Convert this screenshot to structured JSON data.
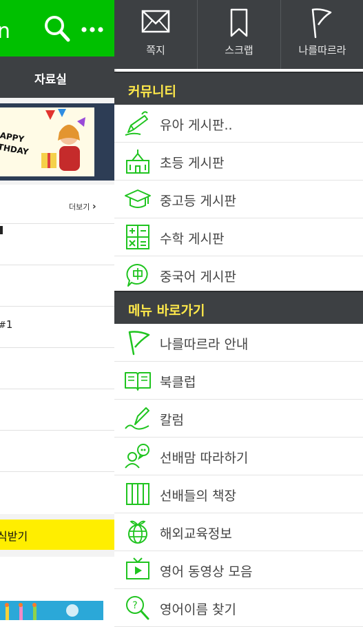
{
  "colors": {
    "brand_green": "#00c000",
    "drawer_dark": "#3d4043",
    "section_text": "#ffe94a",
    "icon_green": "#1fc41f"
  },
  "background_app": {
    "logo_fragment": "n",
    "tab_label": "자료실",
    "banner_text": "APPY\nTHDAY",
    "more_label": "더보기",
    "list_fragments": [
      "1"
    ],
    "yellow_bar_text": "식받기"
  },
  "drawer": {
    "top_buttons": [
      {
        "label": "쪽지",
        "icon": "envelope-icon"
      },
      {
        "label": "스크랩",
        "icon": "bookmark-icon"
      },
      {
        "label": "나를따르라",
        "icon": "flag-icon"
      }
    ],
    "sections": [
      {
        "title": "커뮤니티",
        "items": [
          {
            "label": "유아 게시판..",
            "icon": "pencil-icon"
          },
          {
            "label": "초등 게시판",
            "icon": "school-building-icon"
          },
          {
            "label": "중고등 게시판",
            "icon": "graduation-cap-icon"
          },
          {
            "label": "수학 게시판",
            "icon": "calculator-icon"
          },
          {
            "label": "중국어 게시판",
            "icon": "chinese-speech-icon"
          }
        ]
      },
      {
        "title": "메뉴 바로가기",
        "items": [
          {
            "label": "나를따르라 안내",
            "icon": "flag-icon"
          },
          {
            "label": "북클럽",
            "icon": "open-book-icon"
          },
          {
            "label": "칼럼",
            "icon": "quill-icon"
          },
          {
            "label": "선배맘 따라하기",
            "icon": "people-chat-icon"
          },
          {
            "label": "선배들의 책장",
            "icon": "bookshelf-icon"
          },
          {
            "label": "해외교육정보",
            "icon": "globe-sprout-icon"
          },
          {
            "label": "영어 동영상 모음",
            "icon": "tv-play-icon"
          },
          {
            "label": "영어이름 찾기",
            "icon": "search-question-icon"
          }
        ]
      }
    ]
  }
}
